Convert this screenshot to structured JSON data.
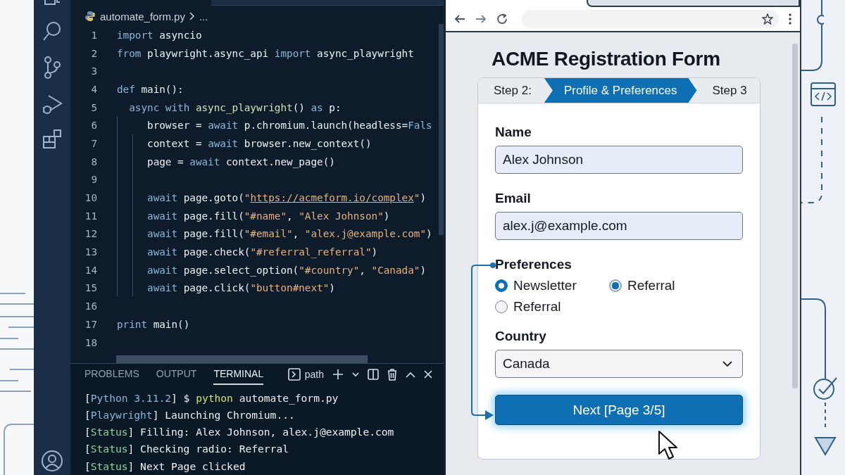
{
  "editor": {
    "breadcrumb": {
      "file": "automate_form.py",
      "more": "..."
    },
    "lines": [
      {
        "number": "1",
        "tokens": [
          {
            "kind": "keyword",
            "text": "import"
          },
          {
            "kind": "plain",
            "text": " asyncio"
          }
        ]
      },
      {
        "number": "2",
        "tokens": [
          {
            "kind": "keyword",
            "text": "from"
          },
          {
            "kind": "plain",
            "text": " playwright.async_api "
          },
          {
            "kind": "keyword",
            "text": "import"
          },
          {
            "kind": "plain",
            "text": " async_playwright"
          }
        ]
      },
      {
        "number": "3"
      },
      {
        "number": "4",
        "tokens": [
          {
            "kind": "keyword",
            "text": "def"
          },
          {
            "kind": "plain",
            "text": " main():"
          }
        ]
      },
      {
        "number": "5",
        "tokens": [
          {
            "kind": "keyword",
            "text": "  async with"
          },
          {
            "kind": "function",
            "text": " async_playwright"
          },
          {
            "kind": "plain",
            "text": "()"
          },
          {
            "kind": "keyword",
            "text": " as"
          },
          {
            "kind": "plain",
            "text": " p:"
          }
        ]
      },
      {
        "number": "6",
        "tokens": [
          {
            "kind": "plain",
            "text": "     browser = "
          },
          {
            "kind": "keyword",
            "text": "await"
          },
          {
            "kind": "plain",
            "text": " p.chromium.launch(headless="
          },
          {
            "kind": "keyword",
            "text": "Fals"
          }
        ]
      },
      {
        "number": "7",
        "tokens": [
          {
            "kind": "plain",
            "text": "     context = "
          },
          {
            "kind": "keyword",
            "text": "await"
          },
          {
            "kind": "plain",
            "text": " browser.new_context()"
          }
        ]
      },
      {
        "number": "8",
        "tokens": [
          {
            "kind": "plain",
            "text": "     page = "
          },
          {
            "kind": "keyword",
            "text": "await"
          },
          {
            "kind": "plain",
            "text": " context.new_page()"
          }
        ]
      },
      {
        "number": "9"
      },
      {
        "number": "10",
        "tokens": [
          {
            "kind": "keyword",
            "text": "     await"
          },
          {
            "kind": "plain",
            "text": " page.goto("
          },
          {
            "kind": "string",
            "text": "\""
          },
          {
            "kind": "link",
            "text": "https://acmeform.io/complex"
          },
          {
            "kind": "string",
            "text": "\""
          },
          {
            "kind": "plain",
            "text": ")"
          }
        ]
      },
      {
        "number": "11",
        "tokens": [
          {
            "kind": "keyword",
            "text": "     await"
          },
          {
            "kind": "plain",
            "text": " page.fill("
          },
          {
            "kind": "string",
            "text": "\"#name\""
          },
          {
            "kind": "plain",
            "text": ", "
          },
          {
            "kind": "string",
            "text": "\"Alex Johnson\""
          },
          {
            "kind": "plain",
            "text": ")"
          }
        ]
      },
      {
        "number": "12",
        "tokens": [
          {
            "kind": "keyword",
            "text": "     await"
          },
          {
            "kind": "plain",
            "text": " page.fill("
          },
          {
            "kind": "string",
            "text": "\"#email\""
          },
          {
            "kind": "plain",
            "text": ", "
          },
          {
            "kind": "string",
            "text": "\"alex.j@example.com\""
          },
          {
            "kind": "plain",
            "text": ")"
          }
        ]
      },
      {
        "number": "13",
        "tokens": [
          {
            "kind": "keyword",
            "text": "     await"
          },
          {
            "kind": "plain",
            "text": " page.check("
          },
          {
            "kind": "string",
            "text": "\"#referral_referral\""
          },
          {
            "kind": "plain",
            "text": ")"
          }
        ]
      },
      {
        "number": "14",
        "tokens": [
          {
            "kind": "keyword",
            "text": "     await"
          },
          {
            "kind": "plain",
            "text": " page.select_option("
          },
          {
            "kind": "string",
            "text": "\"#country\""
          },
          {
            "kind": "plain",
            "text": ", "
          },
          {
            "kind": "string",
            "text": "\"Canada\""
          },
          {
            "kind": "plain",
            "text": ")"
          }
        ]
      },
      {
        "number": "15",
        "tokens": [
          {
            "kind": "keyword",
            "text": "     await"
          },
          {
            "kind": "plain",
            "text": " page.click("
          },
          {
            "kind": "string",
            "text": "\"button#next\""
          },
          {
            "kind": "plain",
            "text": ")"
          }
        ]
      },
      {
        "number": "16"
      },
      {
        "number": "17",
        "tokens": [
          {
            "kind": "keyword",
            "text": "print"
          },
          {
            "kind": "plain",
            "text": " main()"
          }
        ]
      },
      {
        "number": "18"
      }
    ]
  },
  "panel": {
    "tabs": [
      {
        "label": "PROBLEMS",
        "selected": false
      },
      {
        "label": "OUTPUT",
        "selected": false
      },
      {
        "label": "TERMINAL",
        "selected": true
      }
    ],
    "shell": "path",
    "lines": [
      {
        "tokens": [
          {
            "kind": "punct",
            "text": "["
          },
          {
            "kind": "info",
            "text": "Python 3.11.2"
          },
          {
            "kind": "punct",
            "text": "]"
          },
          {
            "kind": "plain",
            "text": " $ "
          },
          {
            "kind": "command",
            "text": "python"
          },
          {
            "kind": "plain",
            "text": " automate_form.py"
          }
        ]
      },
      {
        "tokens": [
          {
            "kind": "punct",
            "text": "["
          },
          {
            "kind": "info",
            "text": "Playwright"
          },
          {
            "kind": "punct",
            "text": "]"
          },
          {
            "kind": "plain",
            "text": " Launching Chromium..."
          }
        ]
      },
      {
        "tokens": [
          {
            "kind": "punct",
            "text": "["
          },
          {
            "kind": "status",
            "text": "Status"
          },
          {
            "kind": "punct",
            "text": "]"
          },
          {
            "kind": "plain",
            "text": " Filling: Alex Johnson, alex.j@example.com"
          }
        ]
      },
      {
        "tokens": [
          {
            "kind": "punct",
            "text": "["
          },
          {
            "kind": "status",
            "text": "Status"
          },
          {
            "kind": "punct",
            "text": "]"
          },
          {
            "kind": "plain",
            "text": " Checking radio: Referral"
          }
        ]
      },
      {
        "tokens": [
          {
            "kind": "punct",
            "text": "["
          },
          {
            "kind": "status",
            "text": "Status"
          },
          {
            "kind": "punct",
            "text": "]"
          },
          {
            "kind": "plain",
            "text": " Next Page clicked"
          }
        ]
      }
    ]
  },
  "form": {
    "title": "ACME Registration Form",
    "steps": [
      {
        "label": "Step 2:",
        "selected": false
      },
      {
        "label": "Profile & Preferences",
        "selected": true
      },
      {
        "label": "Step 3",
        "selected": false
      }
    ],
    "fields": [
      {
        "kind": "text",
        "label": "Name",
        "value": "Alex Johnson"
      },
      {
        "kind": "text",
        "label": "Email",
        "value": "alex.j@example.com"
      },
      {
        "kind": "radios",
        "label": "Preferences",
        "options": [
          {
            "label": "Newsletter",
            "selected": true
          },
          {
            "label": "Referral",
            "selected": true
          },
          {
            "label": "Referral",
            "selected": false
          }
        ]
      },
      {
        "kind": "select",
        "label": "Country",
        "value": "Canada"
      }
    ],
    "button": "Next [Page 3/5]"
  }
}
